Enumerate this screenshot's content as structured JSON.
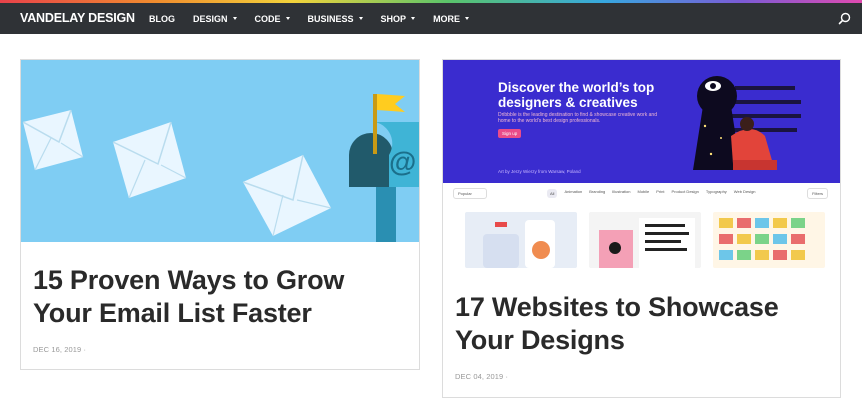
{
  "site": {
    "brand": "VANDELAY DESIGN"
  },
  "nav": {
    "items": [
      {
        "label": "BLOG",
        "dropdown": false
      },
      {
        "label": "DESIGN",
        "dropdown": true
      },
      {
        "label": "CODE",
        "dropdown": true
      },
      {
        "label": "BUSINESS",
        "dropdown": true
      },
      {
        "label": "SHOP",
        "dropdown": true
      },
      {
        "label": "MORE",
        "dropdown": true
      }
    ],
    "search_icon": "search-icon"
  },
  "posts": [
    {
      "title": "15 Proven Ways to Grow Your Email List Faster",
      "date": "DEC 16, 2019 ·"
    },
    {
      "title": "17 Websites to Showcase Your Designs",
      "date": "DEC 04, 2019 ·"
    }
  ],
  "dribbble": {
    "headline": "Discover the world’s top designers & creatives",
    "subtext": "Dribbble is the leading destination to find & showcase creative work and home to the world's best design professionals.",
    "signup": "Sign up",
    "art_credit": "Art by Jerzy Wierzy from Warsaw, Poland",
    "sort": "Popular",
    "categories": [
      "All",
      "Animation",
      "Branding",
      "Illustration",
      "Mobile",
      "Print",
      "Product Design",
      "Typography",
      "Web Design"
    ],
    "filters": "Filters"
  },
  "colors": {
    "navbar": "#2f3236",
    "email_bg": "#7fcdf3",
    "mailbox": "#3fb4d6",
    "flag": "#ffcc1f",
    "dribbble_blue": "#3a2ccf",
    "dribbble_pink": "#ea4c89"
  }
}
